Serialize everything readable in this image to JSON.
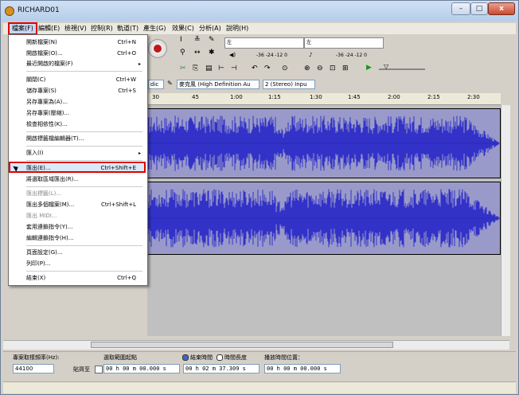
{
  "window": {
    "title": "RICHARD01",
    "minimize": "–",
    "maximize": "□",
    "close": "x"
  },
  "menubar": [
    "檔案(F)",
    "編輯(E)",
    "檢視(V)",
    "控制(R)",
    "軌道(T)",
    "產生(G)",
    "效果(C)",
    "分析(A)",
    "說明(H)"
  ],
  "toolbar": {
    "meter_left_label": "左",
    "meter_right_label": "右",
    "meter_scale_1": "-36  -24  -12  0",
    "meter_scale_2": "-36  -24  -12  0",
    "host_combo": "dic",
    "input_combo": "麥克風 (High Definition Au",
    "channels_combo": "2 (Stereo) Inpu"
  },
  "ruler": [
    "30",
    "45",
    "1:00",
    "1:15",
    "1:30",
    "1:45",
    "2:00",
    "2:15",
    "2:30"
  ],
  "file_menu": {
    "items": [
      {
        "label": "開新檔案(N)",
        "shortcut": "Ctrl+N"
      },
      {
        "label": "開啟檔案(O)...",
        "shortcut": "Ctrl+O"
      },
      {
        "label": "最近開啟的檔案(F)",
        "shortcut": "",
        "submenu": "▸"
      },
      {
        "label": "關閉(C)",
        "shortcut": "Ctrl+W"
      },
      {
        "label": "儲存專案(S)",
        "shortcut": "Ctrl+S"
      },
      {
        "label": "另存專案為(A)...",
        "shortcut": ""
      },
      {
        "label": "另存專案(壓縮)...",
        "shortcut": ""
      },
      {
        "label": "檢查相依性(K)...",
        "shortcut": ""
      },
      {
        "label": "開啟標籤檔編輯器(T)...",
        "shortcut": ""
      },
      {
        "label": "匯入(I)",
        "shortcut": "",
        "submenu": "▸"
      },
      {
        "label": "匯出(E)...",
        "shortcut": "Ctrl+Shift+E"
      },
      {
        "label": "將選取區域匯出(R)...",
        "shortcut": ""
      },
      {
        "label": "匯出標籤(L)...",
        "shortcut": ""
      },
      {
        "label": "匯出多個檔案(M)...",
        "shortcut": "Ctrl+Shift+L"
      },
      {
        "label": "匯出 MIDI...",
        "shortcut": ""
      },
      {
        "label": "套用連鎖指令(Y)...",
        "shortcut": ""
      },
      {
        "label": "編輯連鎖指令(H)...",
        "shortcut": ""
      },
      {
        "label": "頁面設定(G)...",
        "shortcut": ""
      },
      {
        "label": "列印(P)...",
        "shortcut": ""
      },
      {
        "label": "結束(X)",
        "shortcut": "Ctrl+Q"
      }
    ]
  },
  "selection": {
    "rate_label": "專案取樣頻率(Hz):",
    "rate_value": "44100",
    "snap_label": "貼齊至",
    "start_label": "選取範圍起點",
    "start_value": "00 h 00 m 00.000 s",
    "end_radio": "結束時間",
    "length_radio": "時間長度",
    "end_value": "00 h 02 m 37.309 s",
    "pos_label": "播放時間位置：",
    "pos_value": "00 h 00 m 00.000 s"
  },
  "colors": {
    "waveform": "#3232c8",
    "track_bg": "#9a9aca",
    "highlight": "#e00000"
  }
}
